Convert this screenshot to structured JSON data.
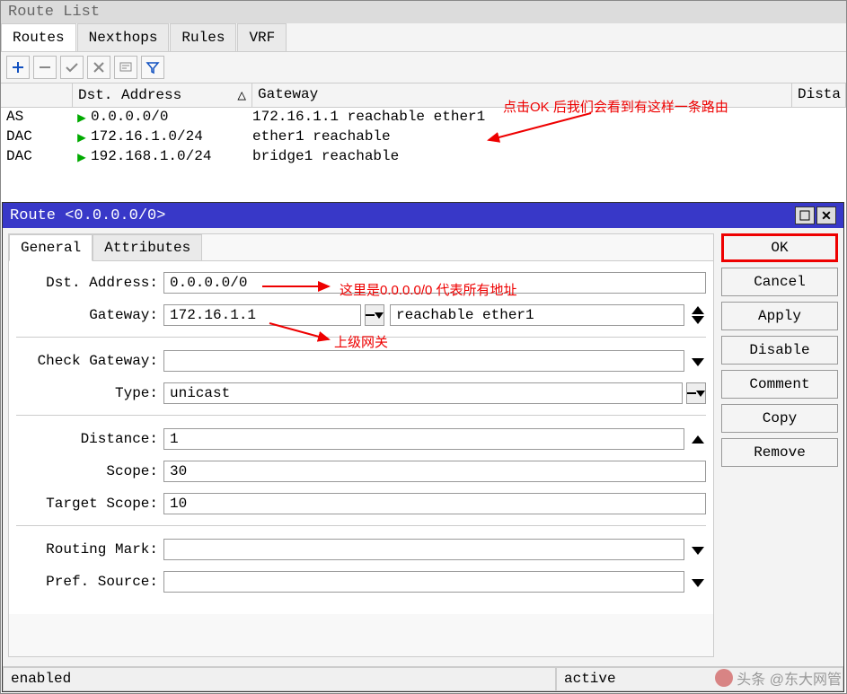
{
  "outerWindow": {
    "title": "Route List",
    "tabs": [
      "Routes",
      "Nexthops",
      "Rules",
      "VRF"
    ]
  },
  "tableHeaders": {
    "dst": "Dst. Address",
    "gateway": "Gateway",
    "distance": "Dista"
  },
  "routes": [
    {
      "flags": "AS",
      "dst": "0.0.0.0/0",
      "gateway": "172.16.1.1 reachable ether1"
    },
    {
      "flags": "DAC",
      "dst": "172.16.1.0/24",
      "gateway": "ether1 reachable"
    },
    {
      "flags": "DAC",
      "dst": "192.168.1.0/24",
      "gateway": "bridge1 reachable"
    }
  ],
  "dialog": {
    "title": "Route <0.0.0.0/0>",
    "tabs": [
      "General",
      "Attributes"
    ],
    "form": {
      "labels": {
        "dst": "Dst. Address:",
        "gateway": "Gateway:",
        "check": "Check Gateway:",
        "type": "Type:",
        "distance": "Distance:",
        "scope": "Scope:",
        "targetScope": "Target Scope:",
        "routingMark": "Routing Mark:",
        "prefSource": "Pref. Source:"
      },
      "values": {
        "dst": "0.0.0.0/0",
        "gateway": "172.16.1.1",
        "gatewayStatus": "reachable ether1",
        "check": "",
        "type": "unicast",
        "distance": "1",
        "scope": "30",
        "targetScope": "10",
        "routingMark": "",
        "prefSource": ""
      }
    },
    "buttons": {
      "ok": "OK",
      "cancel": "Cancel",
      "apply": "Apply",
      "disable": "Disable",
      "comment": "Comment",
      "copy": "Copy",
      "remove": "Remove"
    },
    "status": {
      "left": "enabled",
      "right": "active"
    }
  },
  "annotations": {
    "top": "点击OK 后我们会看到有这样一条路由",
    "dst": "这里是0.0.0.0/0 代表所有地址",
    "gateway": "上级网关"
  },
  "watermark": "头条 @东大网管"
}
